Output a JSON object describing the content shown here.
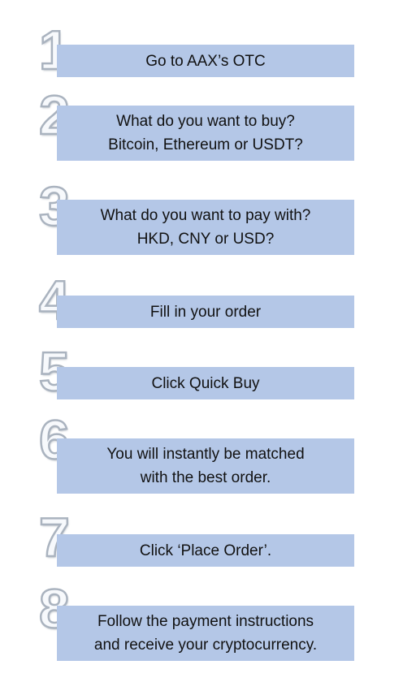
{
  "steps": [
    {
      "number": "1",
      "text": "Go to AAX’s OTC"
    },
    {
      "number": "2",
      "text": "What do you want to buy?\nBitcoin, Ethereum or USDT?"
    },
    {
      "number": "3",
      "text": "What do you want to pay with?\nHKD, CNY or USD?"
    },
    {
      "number": "4",
      "text": "Fill in your order"
    },
    {
      "number": "5",
      "text": "Click Quick Buy"
    },
    {
      "number": "6",
      "text": "You will instantly be matched\nwith the best order."
    },
    {
      "number": "7",
      "text": "Click ‘Place Order’."
    },
    {
      "number": "8",
      "text": "Follow the payment instructions\nand receive your cryptocurrency."
    }
  ],
  "colors": {
    "box_fill": "#b4c7e7",
    "number_outline": "#aab3bf",
    "text": "#111111"
  }
}
